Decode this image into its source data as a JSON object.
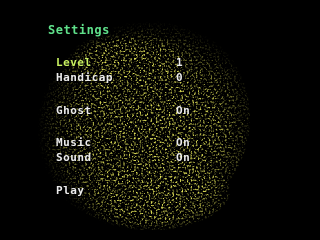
{
  "screen": {
    "title": "Settings"
  },
  "menu": {
    "items": [
      {
        "label": "Level",
        "value": "1"
      },
      {
        "label": "Handicap",
        "value": "0"
      },
      {
        "label": "Ghost",
        "value": "On"
      },
      {
        "label": "Music",
        "value": "On"
      },
      {
        "label": "Sound",
        "value": "On"
      },
      {
        "label": "Play",
        "value": ""
      }
    ],
    "selected_index": 0
  },
  "colors": {
    "background": "#000000",
    "title": "#5fe08a",
    "selected": "#c8f060",
    "text": "#ececec",
    "art": "#c8c820"
  },
  "decor": {
    "background_art_icon": "textured-creature-artwork"
  }
}
